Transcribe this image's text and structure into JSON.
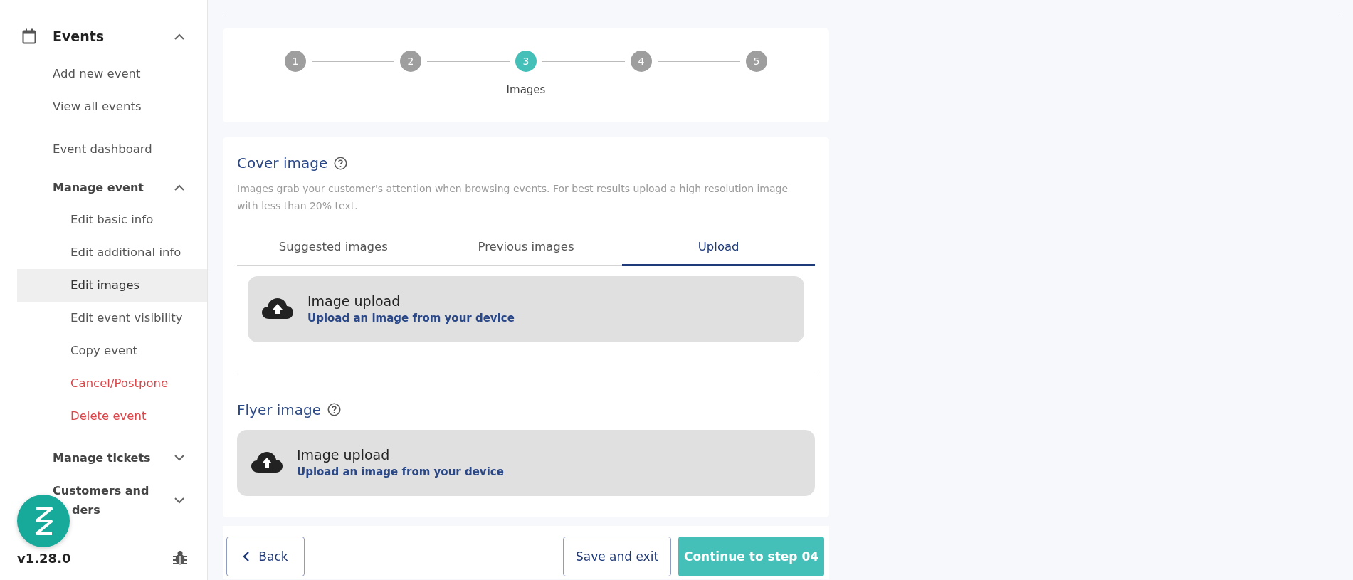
{
  "sidebar": {
    "section": {
      "label": "Events",
      "expanded": true
    },
    "items": [
      {
        "label": "Add new event",
        "kind": "link"
      },
      {
        "label": "View all events",
        "kind": "link"
      },
      {
        "label": "Event dashboard",
        "kind": "link"
      },
      {
        "label": "Manage event",
        "kind": "group",
        "expanded": true,
        "children": [
          {
            "label": "Edit basic info",
            "selected": false,
            "danger": false
          },
          {
            "label": "Edit additional info",
            "selected": false,
            "danger": false
          },
          {
            "label": "Edit images",
            "selected": true,
            "danger": false
          },
          {
            "label": "Edit event visibility",
            "selected": false,
            "danger": false
          },
          {
            "label": "Copy event",
            "selected": false,
            "danger": false
          },
          {
            "label": "Cancel/Postpone",
            "selected": false,
            "danger": true
          },
          {
            "label": "Delete event",
            "selected": false,
            "danger": true
          }
        ]
      },
      {
        "label": "Manage tickets",
        "kind": "group",
        "expanded": false
      },
      {
        "label": "Customers and",
        "label_continued": "ders",
        "kind": "group",
        "expanded": false
      }
    ],
    "version": "v1.28.0"
  },
  "stepper": {
    "steps": [
      {
        "number": "1",
        "selected": false
      },
      {
        "number": "2",
        "selected": false
      },
      {
        "number": "3",
        "selected": true
      },
      {
        "number": "4",
        "selected": false
      },
      {
        "number": "5",
        "selected": false
      }
    ],
    "current_label": "Images"
  },
  "cover_image": {
    "title": "Cover image",
    "description": "Images grab your customer's attention when browsing events. For best results upload a high resolution image with less than 20% text.",
    "tabs": [
      {
        "label": "Suggested images",
        "selected": false
      },
      {
        "label": "Previous images",
        "selected": false
      },
      {
        "label": "Upload",
        "selected": true
      }
    ],
    "upload": {
      "title": "Image upload",
      "subtitle": "Upload an image from your device"
    }
  },
  "flyer_image": {
    "title": "Flyer image",
    "upload": {
      "title": "Image upload",
      "subtitle": "Upload an image from your device"
    }
  },
  "footer": {
    "back": "Back",
    "save": "Save and exit",
    "continue": "Continue to step 04"
  }
}
